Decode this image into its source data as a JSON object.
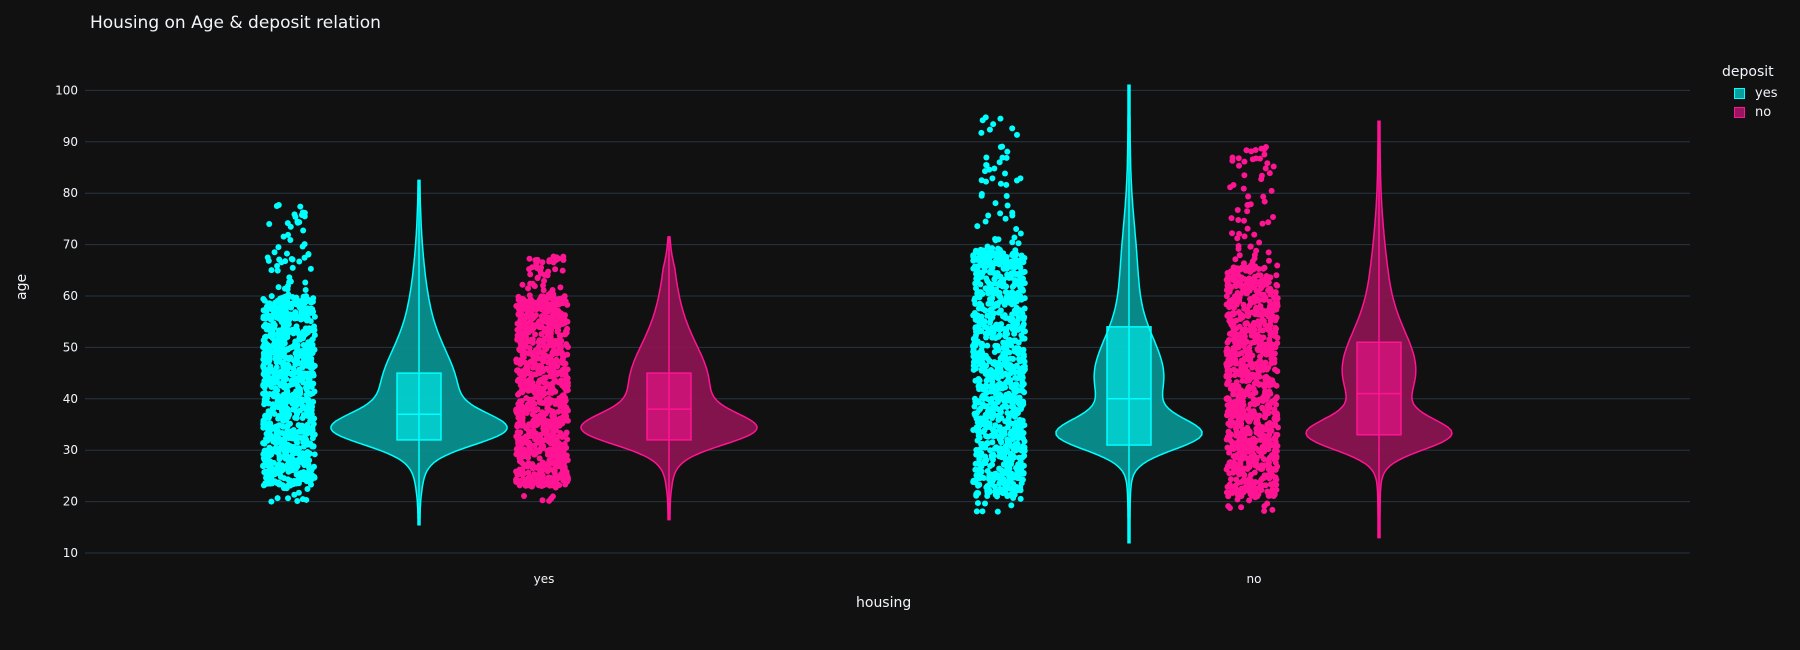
{
  "chart_data": {
    "type": "violin",
    "title": "Housing on Age & deposit relation",
    "xlabel": "housing",
    "ylabel": "age",
    "categories": [
      "yes",
      "no"
    ],
    "ylim": [
      8,
      104
    ],
    "yticks": [
      10,
      20,
      30,
      40,
      50,
      60,
      70,
      80,
      90,
      100
    ],
    "grid": true,
    "legend": {
      "title": "deposit",
      "placement": "top-right"
    },
    "series": [
      {
        "name": "yes",
        "color": "#00ffff",
        "fill": "#0a8f8f",
        "groups": [
          {
            "category": "yes",
            "min": 15.5,
            "max": 82.5,
            "q1": 32,
            "median": 37,
            "q3": 45,
            "points_min": 20,
            "points_max": 78,
            "density_peak": 34
          },
          {
            "category": "no",
            "min": 12,
            "max": 101,
            "q1": 31,
            "median": 40,
            "q3": 54,
            "points_min": 18,
            "points_max": 95,
            "density_peak": 33
          }
        ]
      },
      {
        "name": "no",
        "color": "#ff1493",
        "fill": "#8a1450",
        "groups": [
          {
            "category": "yes",
            "min": 16.5,
            "max": 71.5,
            "q1": 32,
            "median": 38,
            "q3": 45,
            "points_min": 20,
            "points_max": 68,
            "density_peak": 34
          },
          {
            "category": "no",
            "min": 13,
            "max": 94,
            "q1": 33,
            "median": 41,
            "q3": 51,
            "points_min": 18,
            "points_max": 89,
            "density_peak": 33
          }
        ]
      }
    ]
  }
}
